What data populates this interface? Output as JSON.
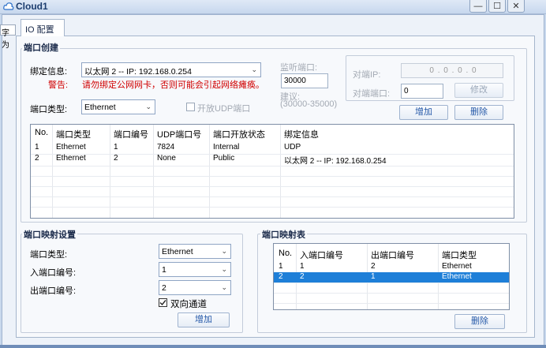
{
  "window": {
    "title": "Cloud1",
    "min_label": "—",
    "max_label": "☐",
    "close_label": "✕"
  },
  "side_label": "字为",
  "tab": {
    "label": "IO 配置"
  },
  "port_create": {
    "title": "端口创建",
    "bind_label": "绑定信息:",
    "bind_value": "以太网 2 -- IP: 192.168.0.254",
    "warn_label": "警告:",
    "warn_text": "请勿绑定公网网卡，否则可能会引起网络瘫痪。",
    "port_type_label": "端口类型:",
    "port_type_value": "Ethernet",
    "udp_open_label": "开放UDP端口",
    "listen_label": "监听端口:",
    "listen_value": "30000",
    "suggest_label": "建议:",
    "suggest_range": "(30000-35000)",
    "peer_ip_label": "对端IP:",
    "peer_ip_value": "0 . 0 . 0 . 0",
    "peer_port_label": "对端端口:",
    "peer_port_value": "0",
    "modify_button": "修改",
    "add_button": "增加",
    "delete_button": "删除",
    "table": {
      "headers": [
        "No.",
        "端口类型",
        "端口编号",
        "UDP端口号",
        "端口开放状态",
        "绑定信息"
      ],
      "rows": [
        [
          "1",
          "Ethernet",
          "1",
          "7824",
          "Internal",
          "UDP"
        ],
        [
          "2",
          "Ethernet",
          "2",
          "None",
          "Public",
          "以太网 2 -- IP: 192.168.0.254"
        ]
      ]
    }
  },
  "port_map_settings": {
    "title": "端口映射设置",
    "port_type_label": "端口类型:",
    "port_type_value": "Ethernet",
    "in_port_label": "入端口编号:",
    "in_port_value": "1",
    "out_port_label": "出端口编号:",
    "out_port_value": "2",
    "bidirectional_label": "双向通道",
    "add_button": "增加"
  },
  "port_map_table": {
    "title": "端口映射表",
    "headers": [
      "No.",
      "入端口编号",
      "出端口编号",
      "端口类型"
    ],
    "rows": [
      [
        "1",
        "1",
        "2",
        "Ethernet"
      ],
      [
        "2",
        "2",
        "1",
        "Ethernet"
      ]
    ],
    "selected_row": 1,
    "delete_button": "删除"
  }
}
